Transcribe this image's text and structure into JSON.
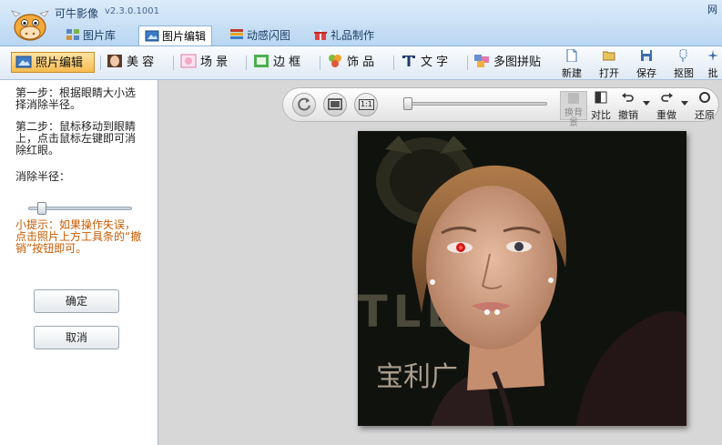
{
  "app": {
    "title": "可牛影像",
    "version": "v2.3.0.1001",
    "corner_text": "网",
    "brand_color": "#b9d6f1"
  },
  "top_tabs": [
    {
      "label": "图片库",
      "icon": "gallery-icon"
    },
    {
      "label": "图片编辑",
      "icon": "image-edit-icon",
      "active": true
    },
    {
      "label": "动感闪图",
      "icon": "animation-icon"
    },
    {
      "label": "礼品制作",
      "icon": "gift-icon"
    }
  ],
  "tools": [
    {
      "label": "照片编辑",
      "icon": "photo-edit-icon",
      "active": true
    },
    {
      "label": "美 容",
      "icon": "beauty-face-icon"
    },
    {
      "label": "场 景",
      "icon": "scene-icon"
    },
    {
      "label": "边 框",
      "icon": "frame-icon"
    },
    {
      "label": "饰 品",
      "icon": "accessory-icon"
    },
    {
      "label": "文 字",
      "icon": "text-icon"
    },
    {
      "label": "多图拼贴",
      "icon": "collage-icon"
    }
  ],
  "file_actions": [
    {
      "label": "新建",
      "icon": "new-file-icon"
    },
    {
      "label": "打开",
      "icon": "open-folder-icon"
    },
    {
      "label": "保存",
      "icon": "save-icon"
    },
    {
      "label": "抠图",
      "icon": "cutout-icon"
    },
    {
      "label": "批",
      "icon": "batch-icon"
    }
  ],
  "panel": {
    "step1": "第一步：根据眼睛大小选择消除半径。",
    "step2": "第二步：鼠标移动到眼睛上，点击鼠标左键即可消除红眼。",
    "radius_label": "消除半径：",
    "radius_value": 0.1,
    "tip": "小提示：如果操作失误，点击照片上方工具条的“撤销”按钮即可。",
    "confirm": "确定",
    "cancel": "取消"
  },
  "view": {
    "zoom_value": 0.0,
    "buttons": [
      {
        "label": "换背景",
        "icon": "change-background-icon",
        "disabled": true
      },
      {
        "label": "对比",
        "icon": "compare-icon"
      },
      {
        "label": "撤销",
        "icon": "undo-icon"
      },
      {
        "label": "重做",
        "icon": "redo-icon"
      },
      {
        "label": "还原",
        "icon": "restore-icon"
      }
    ],
    "actual_size_label": "1:1"
  }
}
